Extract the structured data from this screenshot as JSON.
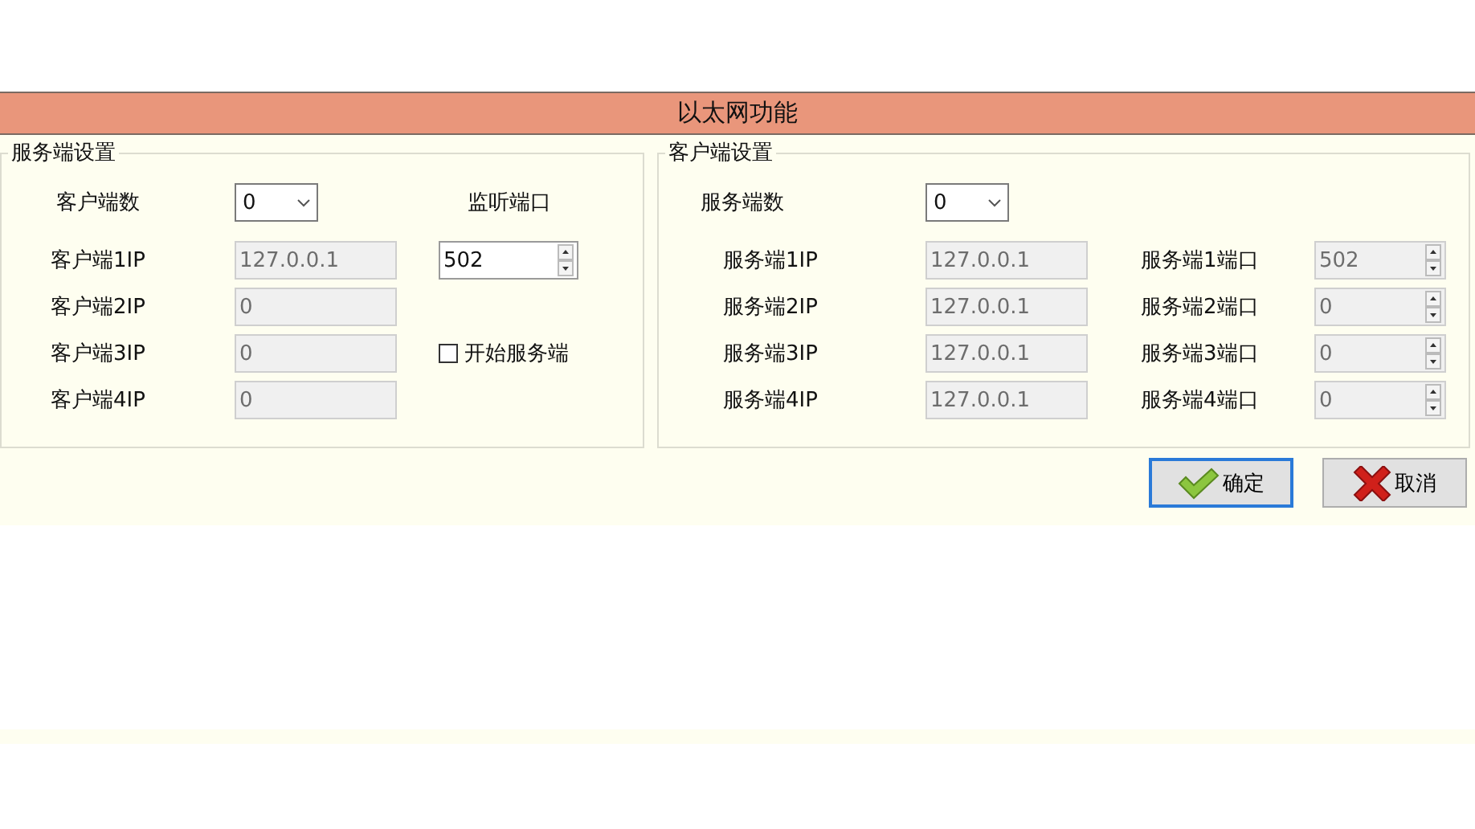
{
  "title": "以太网功能",
  "server_settings": {
    "title": "服务端设置",
    "client_count_label": "客户端数",
    "client_count": "0",
    "listen_port_label": "监听端口",
    "listen_port": {
      "value": "502",
      "disabled": false
    },
    "start_server": {
      "label": "开始服务端",
      "checked": false
    },
    "clients": [
      {
        "label": "客户端1IP",
        "value": "127.0.0.1",
        "disabled": true
      },
      {
        "label": "客户端2IP",
        "value": "0",
        "disabled": true
      },
      {
        "label": "客户端3IP",
        "value": "0",
        "disabled": true
      },
      {
        "label": "客户端4IP",
        "value": "0",
        "disabled": true
      }
    ]
  },
  "client_settings": {
    "title": "客户端设置",
    "server_count_label": "服务端数",
    "server_count": "0",
    "servers": [
      {
        "ip_label": "服务端1IP",
        "ip": "127.0.0.1",
        "port_label": "服务端1端口",
        "port": "502",
        "disabled": true
      },
      {
        "ip_label": "服务端2IP",
        "ip": "127.0.0.1",
        "port_label": "服务端2端口",
        "port": "0",
        "disabled": true
      },
      {
        "ip_label": "服务端3IP",
        "ip": "127.0.0.1",
        "port_label": "服务端3端口",
        "port": "0",
        "disabled": true
      },
      {
        "ip_label": "服务端4IP",
        "ip": "127.0.0.1",
        "port_label": "服务端4端口",
        "port": "0",
        "disabled": true
      }
    ]
  },
  "buttons": [
    {
      "label": "确定",
      "kind": "ok",
      "focused": true
    },
    {
      "label": "取消",
      "kind": "cancel",
      "focused": false
    }
  ]
}
